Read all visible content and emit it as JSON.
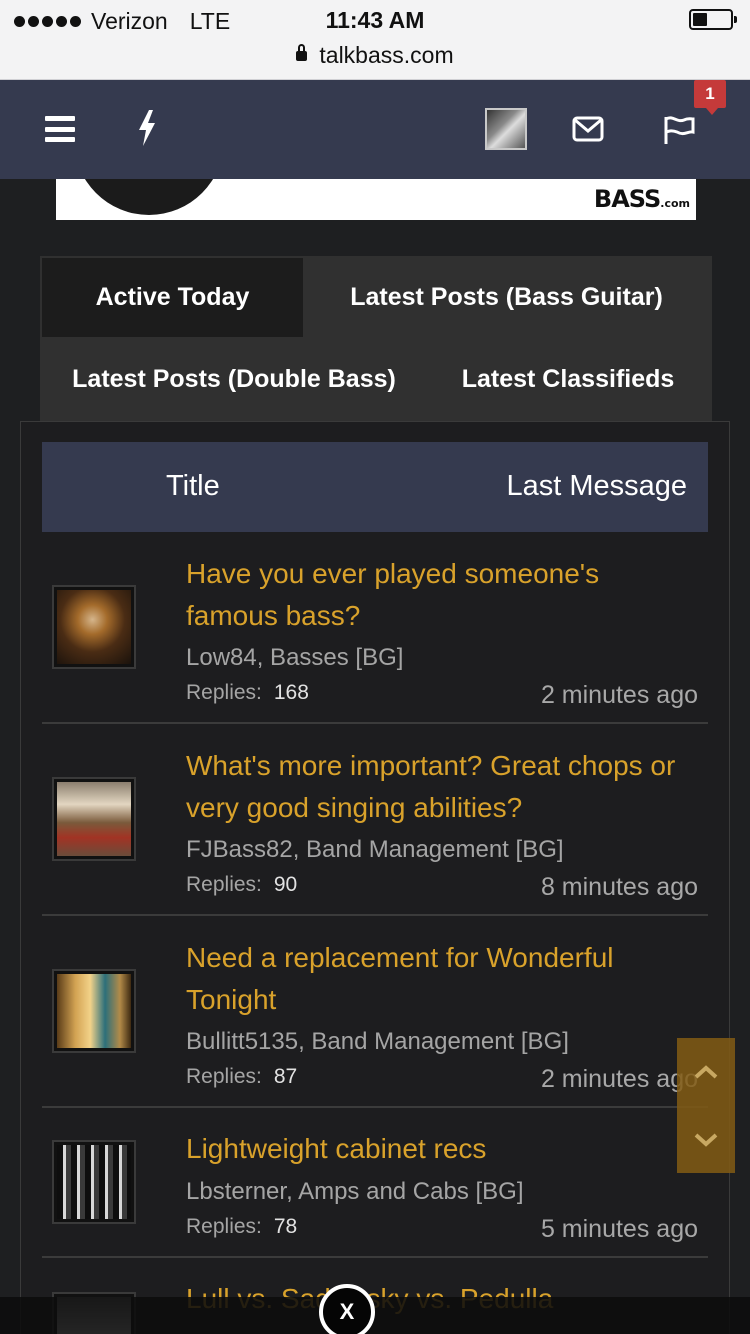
{
  "status_bar": {
    "carrier": "Verizon",
    "network": "LTE",
    "time": "11:43 AM",
    "url": "talkbass.com"
  },
  "navbar": {
    "alert_count": "1"
  },
  "ad": {
    "logo_text": "BASS",
    "logo_suffix": ".com"
  },
  "tabs": [
    {
      "label": "Active Today",
      "active": true
    },
    {
      "label": "Latest Posts (Bass Guitar)",
      "active": false
    },
    {
      "label": "Latest Posts (Double Bass)",
      "active": false
    },
    {
      "label": "Latest Classifieds",
      "active": false
    }
  ],
  "table": {
    "header_title": "Title",
    "header_last": "Last Message",
    "replies_label": "Replies:",
    "rows": [
      {
        "title": "Have you ever played someone's famous bass?",
        "meta": "Low84, Basses [BG]",
        "replies": "168",
        "time": "2 minutes ago"
      },
      {
        "title": "What's more important? Great chops or very good singing abilities?",
        "meta": "FJBass82, Band Management [BG]",
        "replies": "90",
        "time": "8 minutes ago"
      },
      {
        "title": "Need a replacement for Wonderful Tonight",
        "meta": "Bullitt5135, Band Management [BG]",
        "replies": "87",
        "time": "2 minutes ago"
      },
      {
        "title": "Lightweight cabinet recs",
        "meta": "Lbsterner, Amps and Cabs [BG]",
        "replies": "78",
        "time": "5 minutes ago"
      },
      {
        "title": "Lull vs. Sadowsky vs. Pedulla"
      }
    ]
  },
  "close_ad": {
    "label": "X"
  },
  "colors": {
    "navbar": "#353a4f",
    "thread_title": "#d9a22b",
    "background": "#1e1f21"
  }
}
